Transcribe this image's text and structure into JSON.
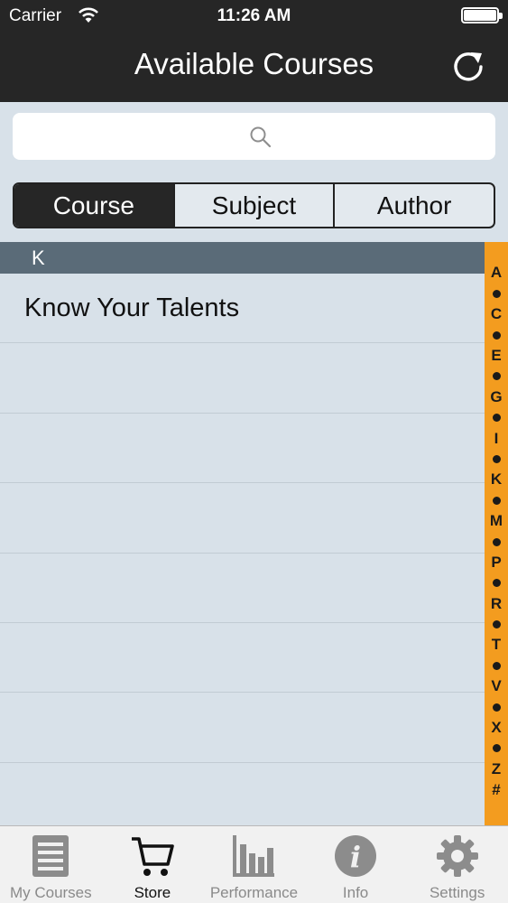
{
  "status": {
    "carrier": "Carrier",
    "time": "11:26 AM"
  },
  "nav": {
    "title": "Available Courses"
  },
  "search": {
    "placeholder": ""
  },
  "segments": [
    "Course",
    "Subject",
    "Author"
  ],
  "list": {
    "section": "K",
    "items": [
      "Know Your Talents",
      "",
      "",
      "",
      "",
      "",
      ""
    ]
  },
  "index": [
    "A",
    "•",
    "C",
    "•",
    "E",
    "•",
    "G",
    "•",
    "I",
    "•",
    "K",
    "•",
    "M",
    "•",
    "P",
    "•",
    "R",
    "•",
    "T",
    "•",
    "V",
    "•",
    "X",
    "•",
    "Z",
    "#"
  ],
  "tabs": [
    {
      "label": "My Courses",
      "icon": "list-document-icon"
    },
    {
      "label": "Store",
      "icon": "cart-icon"
    },
    {
      "label": "Performance",
      "icon": "bar-chart-icon"
    },
    {
      "label": "Info",
      "icon": "info-icon"
    },
    {
      "label": "Settings",
      "icon": "gear-icon"
    }
  ],
  "colors": {
    "nav": "#262626",
    "index": "#f39c1f",
    "section": "#5a6b78",
    "background": "#d8e1e9"
  }
}
